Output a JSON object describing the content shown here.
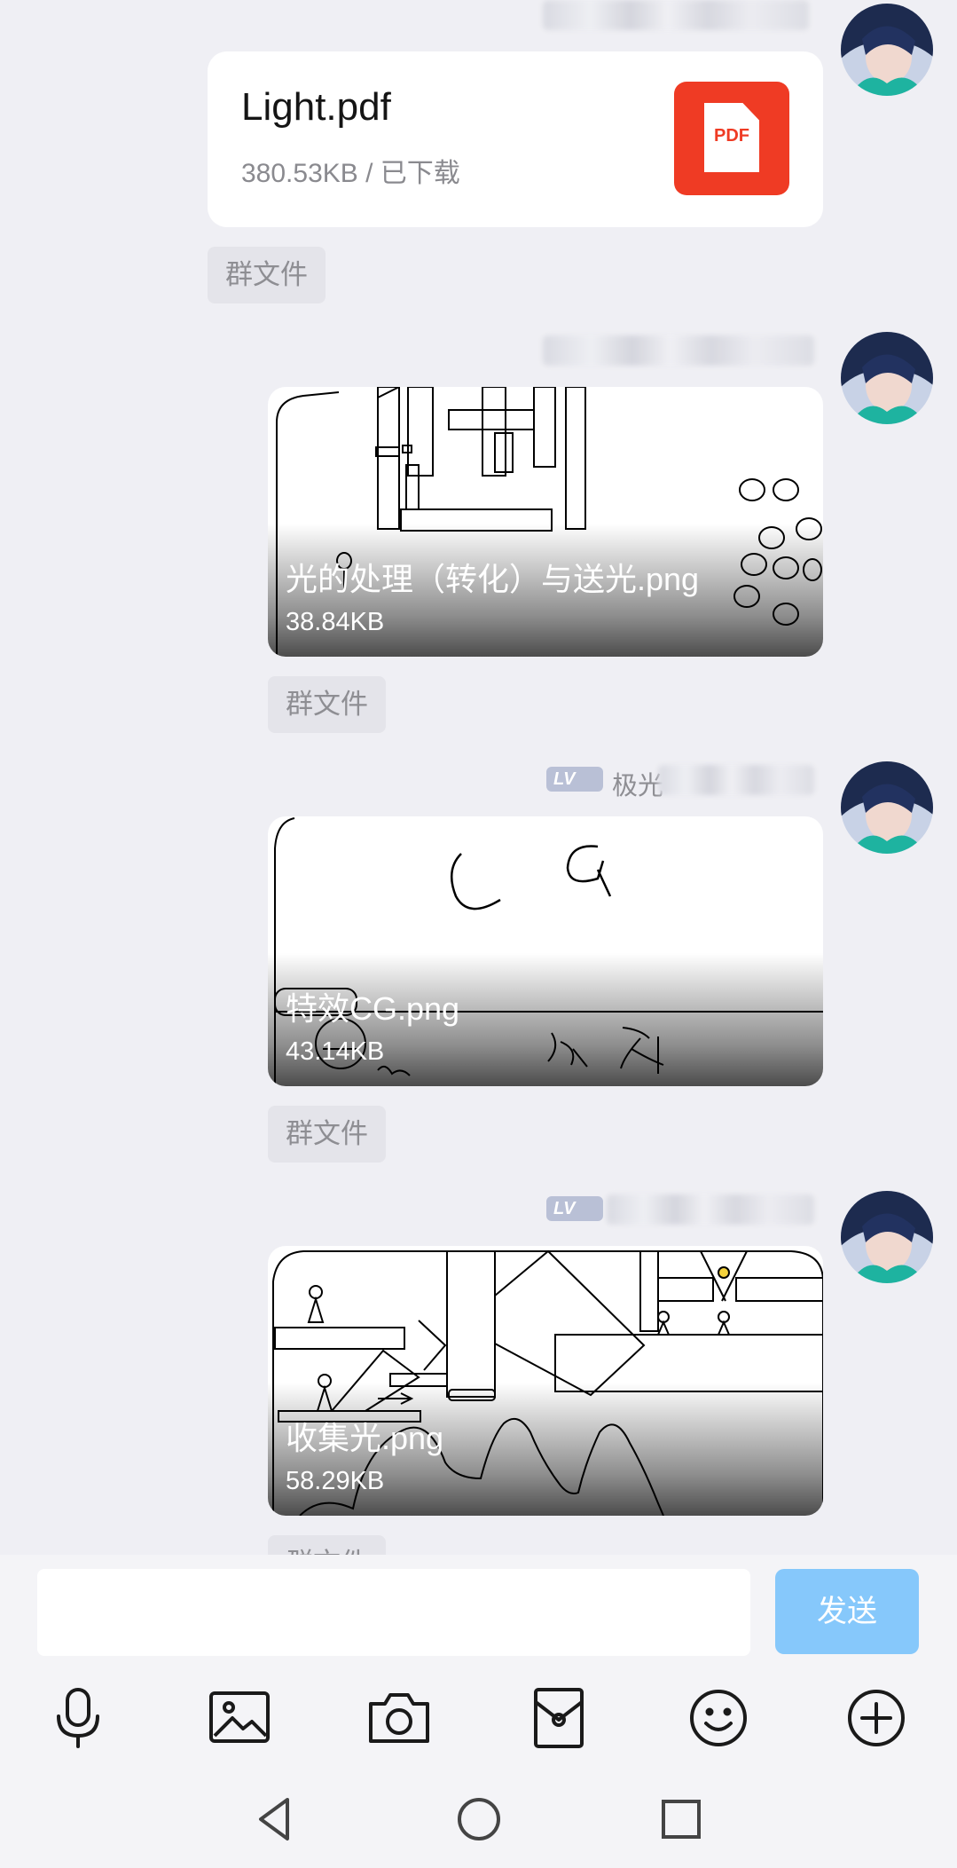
{
  "messages": [
    {
      "type": "file",
      "file_name": "Light.pdf",
      "meta": "380.53KB / 已下载",
      "icon_label": "PDF",
      "tag": "群文件"
    },
    {
      "type": "image",
      "file_name": "光的处理（转化）与送光.png",
      "size": "38.84KB",
      "tag": "群文件"
    },
    {
      "type": "image",
      "level_badge": "LV",
      "sender_visible": "极光",
      "file_name": "特效CG.png",
      "size": "43.14KB",
      "tag": "群文件"
    },
    {
      "type": "image",
      "level_badge": "LV",
      "file_name": "收集光.png",
      "size": "58.29KB",
      "tag": "群文件"
    }
  ],
  "input": {
    "placeholder": "",
    "send_label": "发送"
  },
  "toolbar": [
    "microphone-icon",
    "image-icon",
    "camera-icon",
    "red-packet-icon",
    "emoji-icon",
    "plus-icon"
  ],
  "nav": [
    "back-icon",
    "home-icon",
    "recents-icon"
  ],
  "colors": {
    "background": "#efeff4",
    "pdf_red": "#ef3b24",
    "send_blue": "#86c8fb",
    "tag_bg": "#e4e4ea"
  }
}
